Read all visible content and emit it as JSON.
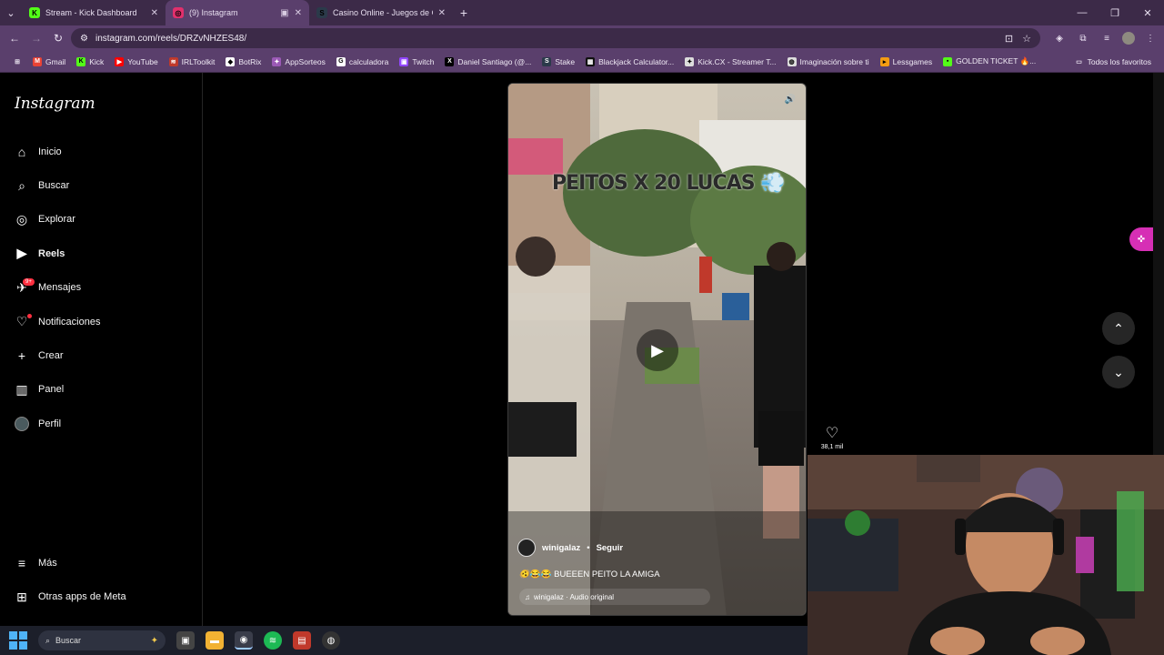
{
  "browser": {
    "tabs": [
      {
        "title": "Stream - Kick Dashboard",
        "icon": "kick-icon",
        "color": "#53fc18",
        "glyph": "K"
      },
      {
        "title": "(9) Instagram",
        "icon": "instagram-icon",
        "color": "#e1306c",
        "glyph": "◎"
      },
      {
        "title": "Casino Online - Juegos de Casi",
        "icon": "stake-icon",
        "color": "#2b3a4a",
        "glyph": "S"
      }
    ],
    "url": "instagram.com/reels/DRZvNHZES48/",
    "bookmarks": [
      {
        "label": "Gmail",
        "icon": "gmail-icon",
        "color": "#ea4335",
        "glyph": "M"
      },
      {
        "label": "Kick",
        "icon": "kick-icon",
        "color": "#53fc18",
        "glyph": "K"
      },
      {
        "label": "YouTube",
        "icon": "youtube-icon",
        "color": "#ff0000",
        "glyph": "▶"
      },
      {
        "label": "IRLToolkit",
        "icon": "irltoolkit-icon",
        "color": "#c0392b",
        "glyph": "≋"
      },
      {
        "label": "BotRix",
        "icon": "botrix-icon",
        "color": "#ffffff",
        "glyph": "◆"
      },
      {
        "label": "AppSorteos",
        "icon": "appsorteos-icon",
        "color": "#9b59b6",
        "glyph": "✦"
      },
      {
        "label": "calculadora",
        "icon": "google-icon",
        "color": "#ffffff",
        "glyph": "G"
      },
      {
        "label": "Twitch",
        "icon": "twitch-icon",
        "color": "#9146ff",
        "glyph": "▣"
      },
      {
        "label": "Daniel Santiago (@...",
        "icon": "x-icon",
        "color": "#000000",
        "glyph": "X"
      },
      {
        "label": "Stake",
        "icon": "stake-icon",
        "color": "#2b3a4a",
        "glyph": "S"
      },
      {
        "label": "Blackjack Calculator...",
        "icon": "blackjack-icon",
        "color": "#111111",
        "glyph": "▦"
      },
      {
        "label": "Kick.CX - Streamer T...",
        "icon": "kickcx-icon",
        "color": "#dddddd",
        "glyph": "✦"
      },
      {
        "label": "Imaginación sobre ti",
        "icon": "globe-icon",
        "color": "#dddddd",
        "glyph": "◍"
      },
      {
        "label": "Lessgames",
        "icon": "lessgames-icon",
        "color": "#f39c12",
        "glyph": "▸"
      },
      {
        "label": "GOLDEN TICKET 🔥...",
        "icon": "golden-ticket-icon",
        "color": "#53fc18",
        "glyph": "▪"
      }
    ],
    "bookmarks_all": "Todos los favoritos"
  },
  "instagram": {
    "logo": "Instagram",
    "nav": [
      {
        "label": "Inicio",
        "icon": "home-icon",
        "glyph": "⌂",
        "bold": false
      },
      {
        "label": "Buscar",
        "icon": "search-icon",
        "glyph": "⌕",
        "bold": false
      },
      {
        "label": "Explorar",
        "icon": "compass-icon",
        "glyph": "◎",
        "bold": false
      },
      {
        "label": "Reels",
        "icon": "reels-icon",
        "glyph": "▶",
        "bold": true
      },
      {
        "label": "Mensajes",
        "icon": "messenger-icon",
        "glyph": "✈",
        "bold": false,
        "badge": "9+"
      },
      {
        "label": "Notificaciones",
        "icon": "heart-icon",
        "glyph": "♡",
        "bold": false,
        "dot": true
      },
      {
        "label": "Crear",
        "icon": "plus-icon",
        "glyph": "+",
        "bold": false
      },
      {
        "label": "Panel",
        "icon": "dashboard-icon",
        "glyph": "▥",
        "bold": false
      },
      {
        "label": "Perfil",
        "icon": "avatar",
        "glyph": "",
        "bold": false
      }
    ],
    "bottom": [
      {
        "label": "Más",
        "icon": "menu-icon",
        "glyph": "≡"
      },
      {
        "label": "Otras apps de Meta",
        "icon": "meta-apps-icon",
        "glyph": "⊞"
      }
    ]
  },
  "reel": {
    "overlay_text": "PEITOS X 20 LUCAS 💨",
    "username": "winigalaz",
    "separator": "•",
    "follow": "Seguir",
    "caption": "🫨😂😂 BUEEEN PEITO LA AMIGA",
    "audio": "winigalaz · Audio original",
    "likes": "38,1 mil"
  },
  "taskbar": {
    "search_label": "Buscar"
  }
}
